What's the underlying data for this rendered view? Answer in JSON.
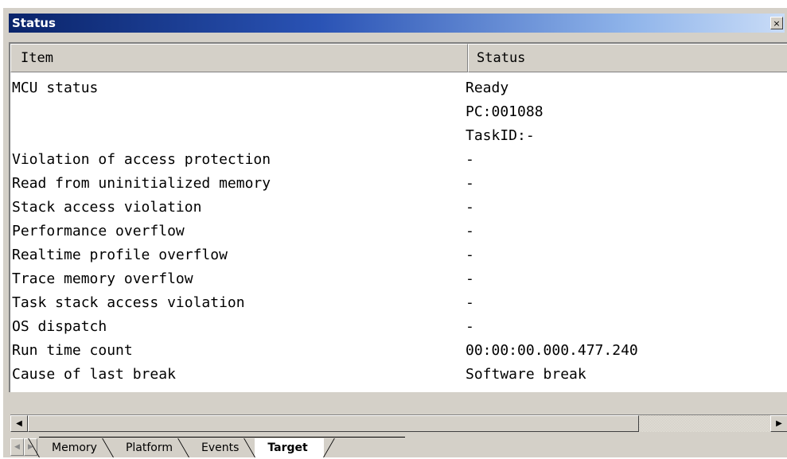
{
  "window": {
    "title": "Status",
    "close_glyph": "×"
  },
  "table": {
    "headers": {
      "item": "Item",
      "status": "Status"
    },
    "rows": [
      {
        "item": "MCU status",
        "status": "Ready"
      },
      {
        "item": "",
        "status": "PC:001088"
      },
      {
        "item": "",
        "status": "TaskID:-"
      },
      {
        "item": "Violation of access protection",
        "status": "-"
      },
      {
        "item": "Read from uninitialized memory",
        "status": "-"
      },
      {
        "item": "Stack access violation",
        "status": "-"
      },
      {
        "item": "Performance overflow",
        "status": "-"
      },
      {
        "item": "Realtime profile overflow",
        "status": "-"
      },
      {
        "item": "Trace memory overflow",
        "status": "-"
      },
      {
        "item": "Task stack access violation",
        "status": "-"
      },
      {
        "item": "OS dispatch",
        "status": "-"
      },
      {
        "item": "Run time count",
        "status": "00:00:00.000.477.240"
      },
      {
        "item": "Cause of last break",
        "status": "Software break"
      }
    ]
  },
  "scrollbar": {
    "left_arrow": "◀",
    "right_arrow": "▶"
  },
  "tabs": {
    "nav_prev": "◀",
    "nav_next": "▶",
    "items": [
      {
        "label": "Memory"
      },
      {
        "label": "Platform"
      },
      {
        "label": "Events"
      },
      {
        "label": "Target",
        "active": true
      }
    ]
  },
  "colors": {
    "title_gradient_start": "#0a246a",
    "title_gradient_end": "#c9dcf7",
    "chrome": "#d4d0c8"
  },
  "icons": {
    "close": "close-icon",
    "scroll_left": "arrow-left-icon",
    "scroll_right": "arrow-right-icon"
  }
}
